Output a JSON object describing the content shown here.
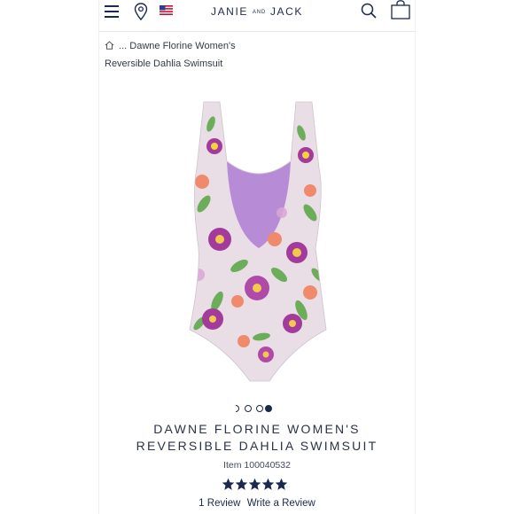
{
  "header": {
    "logo_main_left": "JANIE",
    "logo_small": "AND",
    "logo_main_right": "JACK"
  },
  "breadcrumb": {
    "line1": "... Dawne Florine Women's",
    "line2": "Reversible Dahlia Swimsuit"
  },
  "carousel": {
    "total_dots": 4,
    "active_index": 3
  },
  "product": {
    "title_line1": "DAWNE FLORINE WOMEN'S",
    "title_line2": "REVERSIBLE DAHLIA SWIMSUIT",
    "item_number": "Item 100040532",
    "rating": 5,
    "review_count_label": "1 Review",
    "write_review_label": "Write a Review"
  },
  "colors": {
    "navy": "#1b2a4a",
    "swimsuit_base": "#e9dde6",
    "lining_lavender": "#b88bd6",
    "flower_magenta": "#a33b9c",
    "flower_coral": "#f08a6c",
    "leaf_green": "#5fa84a"
  },
  "icons": [
    "hamburger-menu-icon",
    "location-pin-icon",
    "us-flag-icon",
    "search-icon",
    "shopping-bag-icon",
    "home-icon",
    "star-icon"
  ]
}
